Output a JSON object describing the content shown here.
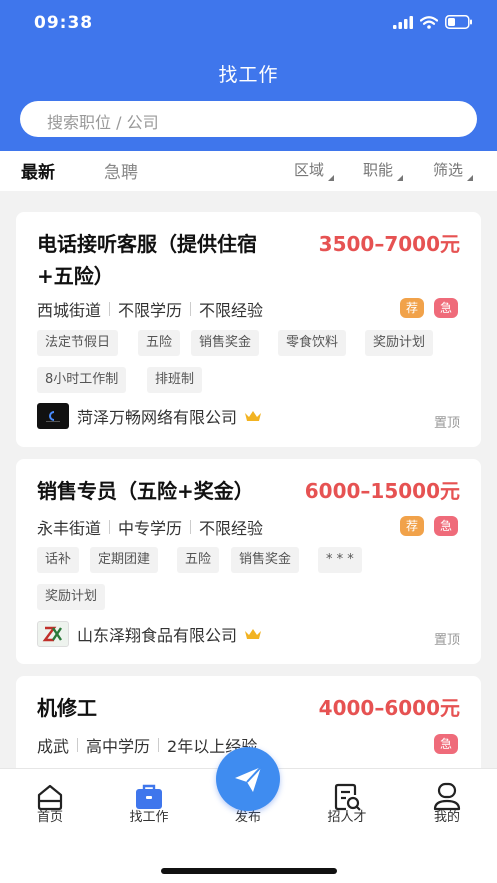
{
  "status": {
    "time": "09:38"
  },
  "header": {
    "title": "找工作",
    "search_placeholder": "搜索职位 / 公司"
  },
  "tabs": {
    "latest": "最新",
    "urgent": "急聘"
  },
  "filters": {
    "region": "区域",
    "function": "职能",
    "filter": "筛选"
  },
  "jobs": [
    {
      "title_line1": "电话接听客服（提供住宿",
      "title_line2": "+五险）",
      "salary": "3500–7000元",
      "info": [
        "西城街道",
        "不限学历",
        "不限经验"
      ],
      "badges": [
        "荐",
        "急"
      ],
      "tags": [
        "法定节假日",
        "五险",
        "销售奖金",
        "零食饮料",
        "奖励计划",
        "8小时工作制",
        "排班制"
      ],
      "company": "菏泽万畅网络有限公司",
      "pin": "置顶"
    },
    {
      "title": "销售专员（五险+奖金）",
      "salary": "6000–15000元",
      "info": [
        "永丰街道",
        "中专学历",
        "不限经验"
      ],
      "badges": [
        "荐",
        "急"
      ],
      "tags": [
        "话补",
        "定期团建",
        "五险",
        "销售奖金",
        "* * *",
        "奖励计划"
      ],
      "company": "山东泽翔食品有限公司",
      "pin": "置顶"
    },
    {
      "title": "机修工",
      "salary": "4000–6000元",
      "info": [
        "成武",
        "高中学历",
        "2年以上经验"
      ],
      "badges": [
        "急"
      ]
    }
  ],
  "bottom_nav": {
    "home": "首页",
    "find_job": "找工作",
    "publish": "发布",
    "recruit": "招人才",
    "mine": "我的"
  },
  "colors": {
    "primary": "#3f76ec",
    "salary": "#e65252",
    "badge_recommend": "#f1a24a",
    "badge_urgent": "#ef6b7a",
    "crown": "#f2b322"
  }
}
